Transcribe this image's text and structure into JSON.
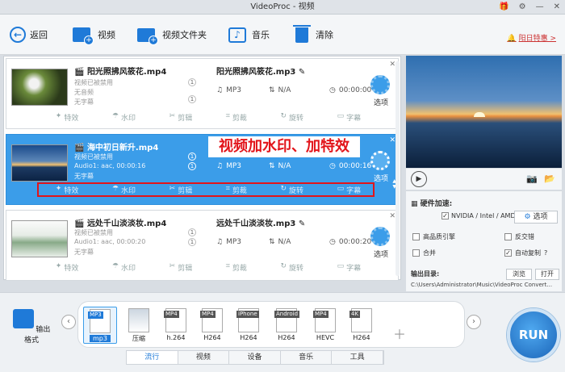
{
  "window": {
    "title": "VideoProc - 视频"
  },
  "toolbar": {
    "back": "返回",
    "video": "视频",
    "video_folder": "视频文件夹",
    "music": "音乐",
    "clear": "清除",
    "notice": "阳日特惠 >"
  },
  "items": [
    {
      "name": "阳光照拂风筱花.mp4",
      "meta": [
        "视频已被禁用",
        "无音频",
        "无字幕"
      ],
      "badges": [
        "1",
        "1"
      ],
      "output_name": "阳光照拂风筱花.mp3",
      "out_format": "MP3",
      "out_size": "N/A",
      "out_duration": "00:00:00",
      "codec_label": "选项"
    },
    {
      "name": "海中初日新升.mp4",
      "meta": [
        "视频已被禁用",
        "Audio1: aac, 00:00:16",
        "无字幕"
      ],
      "badges": [
        "1",
        "1"
      ],
      "output_name": "视频加水印、加特效",
      "out_format": "MP3",
      "out_size": "N/A",
      "out_duration": "00:00:16",
      "codec_label": "选项"
    },
    {
      "name": "远处千山淡淡妆.mp4",
      "meta": [
        "视频已被禁用",
        "Audio1: aac, 00:00:20",
        "无字幕"
      ],
      "badges": [
        "1",
        "1"
      ],
      "output_name": "远处千山淡淡妆.mp3",
      "out_format": "MP3",
      "out_size": "N/A",
      "out_duration": "00:00:20",
      "codec_label": "选项"
    }
  ],
  "edit_actions": [
    "特效",
    "水印",
    "剪辑",
    "剪裁",
    "旋转",
    "字幕"
  ],
  "annotation": "视频加水印、加特效",
  "settings": {
    "hw_accel_label": "硬件加速:",
    "hw_option": "NVIDIA / Intel / AMD",
    "options_btn": "选项",
    "high_quality": "高品质引擎",
    "deinterlace": "反交错",
    "merge": "合并",
    "auto_copy": "自动复制",
    "output_dir_label": "输出目录:",
    "browse": "浏览",
    "open": "打开",
    "output_path": "C:\\Users\\Administrator\\Music\\VideoProc Convert..."
  },
  "bottom": {
    "output_format": "输出格式",
    "formats": [
      {
        "tag": "MP3",
        "sub": "mp3"
      },
      {
        "tag": "",
        "sub": "压缩"
      },
      {
        "tag": "MP4",
        "sub": "h.264"
      },
      {
        "tag": "MP4",
        "sub": "H264"
      },
      {
        "tag": "iPhone",
        "sub": "H264"
      },
      {
        "tag": "Android",
        "sub": "H264"
      },
      {
        "tag": "MP4",
        "sub": "HEVC"
      },
      {
        "tag": "4K",
        "sub": "H264"
      }
    ],
    "tabs": [
      "流行",
      "视频",
      "设备",
      "音乐",
      "工具"
    ],
    "active_tab": "流行",
    "run": "RUN"
  },
  "colors": {
    "accent": "#1f7ad8",
    "selected_row": "#3b9de9",
    "annotation_red": "#e2141a"
  }
}
